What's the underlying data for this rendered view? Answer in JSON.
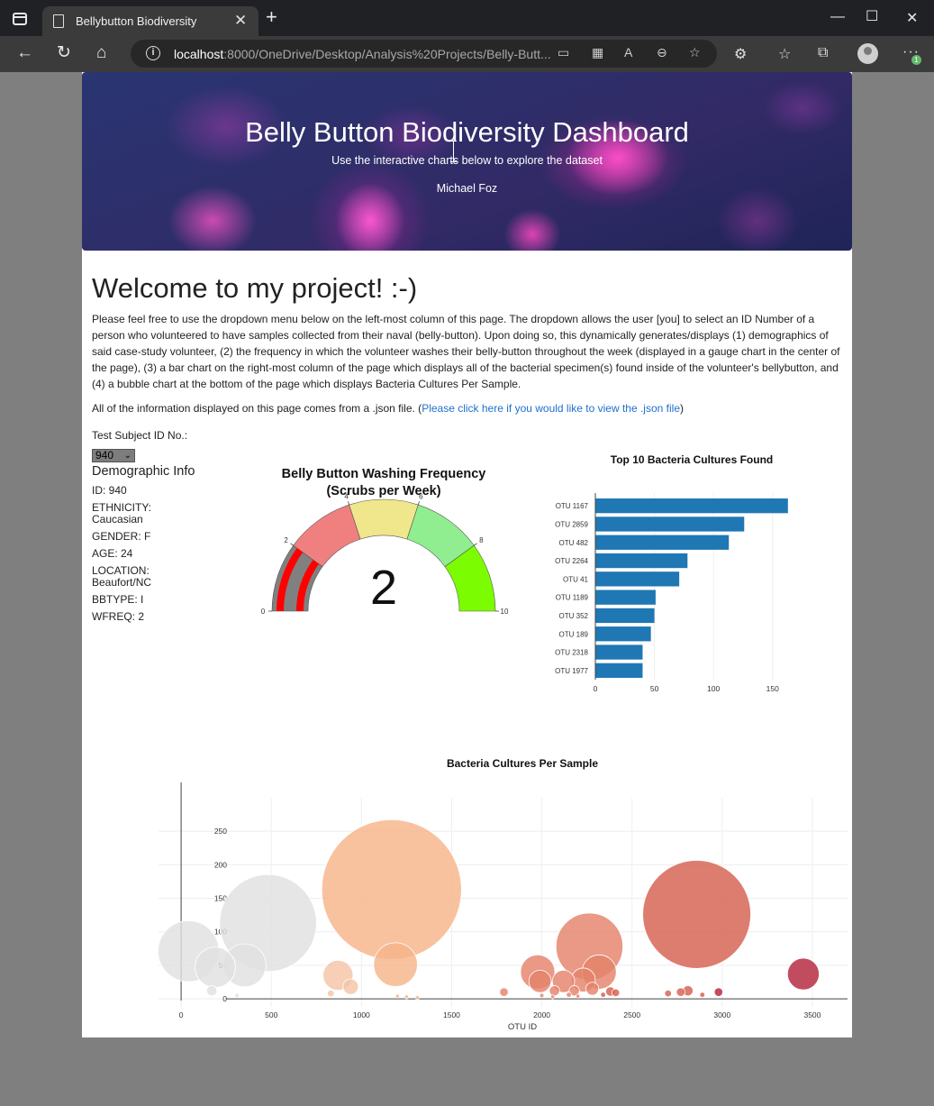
{
  "browser": {
    "tab_title": "Bellybutton Biodiversity",
    "url_host": "localhost",
    "url_rest": ":8000/OneDrive/Desktop/Analysis%20Projects/Belly-Butt...",
    "colors": {
      "chrome": "#202124",
      "toolbar": "#3b3b3b"
    }
  },
  "hero": {
    "title": "Belly Button Biodiversity Dashboard",
    "subtitle": "Use the interactive charts below to explore the dataset",
    "author": "Michael Foz"
  },
  "main": {
    "heading": "Welcome to my project! :-)",
    "intro": "Please feel free to use the dropdown menu below on the left-most column of this page. The dropdown allows the user [you] to select an ID Number of a person who volunteered to have samples collected from their naval (belly-button). Upon doing so, this dynamically generates/displays (1) demographics of said case-study volunteer, (2) the frequency in which the volunteer washes their belly-button throughout the week (displayed in a gauge chart in the center of the page), (3) a bar chart on the right-most column of the page which displays all of the bacterial specimen(s) found inside of the volunteer's bellybutton, and (4) a bubble chart at the bottom of the page which displays Bacteria Cultures Per Sample.",
    "json_prefix": "All of the information displayed on this page comes from a .json file. (",
    "json_link": "Please click here if you would like to view the .json file",
    "json_suffix": ")"
  },
  "selector": {
    "label": "Test Subject ID No.:",
    "value": "940"
  },
  "demographics": {
    "title": "Demographic Info",
    "rows": [
      "ID: 940",
      "ETHNICITY: Caucasian",
      "GENDER: F",
      "AGE: 24",
      "LOCATION: Beaufort/NC",
      "BBTYPE: I",
      "WFREQ: 2"
    ]
  },
  "chart_data": [
    {
      "type": "gauge",
      "title": "Belly Button Washing Frequency",
      "subtitle": "(Scrubs per Week)",
      "value": 2,
      "range": [
        0,
        10
      ],
      "ticks": [
        0,
        2,
        4,
        6,
        8,
        10
      ],
      "steps": [
        {
          "range": [
            0,
            2
          ],
          "color": "#808080"
        },
        {
          "range": [
            2,
            4
          ],
          "color": "#f08080"
        },
        {
          "range": [
            4,
            6
          ],
          "color": "#f0e68c"
        },
        {
          "range": [
            6,
            8
          ],
          "color": "#90ee90"
        },
        {
          "range": [
            8,
            10
          ],
          "color": "#7cfc00"
        }
      ],
      "bar_color": "#ff0000"
    },
    {
      "type": "bar",
      "orientation": "horizontal",
      "title": "Top 10 Bacteria Cultures Found",
      "categories": [
        "OTU 1167",
        "OTU 2859",
        "OTU 482",
        "OTU 2264",
        "OTU 41",
        "OTU 1189",
        "OTU 352",
        "OTU 189",
        "OTU 2318",
        "OTU 1977"
      ],
      "values": [
        163,
        126,
        113,
        78,
        71,
        51,
        50,
        47,
        40,
        40
      ],
      "xticks": [
        0,
        50,
        100,
        150
      ],
      "xlim": [
        0,
        170
      ],
      "color": "#1f77b4"
    },
    {
      "type": "scatter",
      "mode": "bubble",
      "title": "Bacteria Cultures Per Sample",
      "xlabel": "OTU ID",
      "xticks": [
        0,
        500,
        1000,
        1500,
        2000,
        2500,
        3000,
        3500
      ],
      "yticks": [
        0,
        50,
        100,
        150,
        200,
        250
      ],
      "xlim": [
        -350,
        3770
      ],
      "ylim": [
        -12,
        300
      ],
      "points": [
        {
          "x": 41,
          "y": 71
        },
        {
          "x": 189,
          "y": 47
        },
        {
          "x": 352,
          "y": 50
        },
        {
          "x": 482,
          "y": 113
        },
        {
          "x": 870,
          "y": 35
        },
        {
          "x": 940,
          "y": 18
        },
        {
          "x": 1167,
          "y": 163
        },
        {
          "x": 1189,
          "y": 51
        },
        {
          "x": 1977,
          "y": 40
        },
        {
          "x": 1990,
          "y": 26
        },
        {
          "x": 2070,
          "y": 12
        },
        {
          "x": 2120,
          "y": 26
        },
        {
          "x": 2180,
          "y": 12
        },
        {
          "x": 2230,
          "y": 28
        },
        {
          "x": 2264,
          "y": 78
        },
        {
          "x": 2280,
          "y": 15
        },
        {
          "x": 2318,
          "y": 40
        },
        {
          "x": 2859,
          "y": 126
        },
        {
          "x": 3450,
          "y": 37
        },
        {
          "x": 170,
          "y": 12
        },
        {
          "x": 310,
          "y": 5
        },
        {
          "x": 830,
          "y": 8
        },
        {
          "x": 1200,
          "y": 4
        },
        {
          "x": 1250,
          "y": 3
        },
        {
          "x": 1310,
          "y": 2
        },
        {
          "x": 1790,
          "y": 10
        },
        {
          "x": 2000,
          "y": 5
        },
        {
          "x": 2060,
          "y": 3
        },
        {
          "x": 2150,
          "y": 6
        },
        {
          "x": 2200,
          "y": 4
        },
        {
          "x": 2340,
          "y": 6
        },
        {
          "x": 2380,
          "y": 11
        },
        {
          "x": 2410,
          "y": 9
        },
        {
          "x": 2700,
          "y": 8
        },
        {
          "x": 2770,
          "y": 10
        },
        {
          "x": 2810,
          "y": 12
        },
        {
          "x": 2890,
          "y": 6
        },
        {
          "x": 2980,
          "y": 10
        }
      ],
      "colorscale": [
        "#e0e0e0",
        "#f4c4a6",
        "#f7b48a",
        "#e4826a",
        "#d6604f",
        "#b4253c"
      ]
    }
  ]
}
